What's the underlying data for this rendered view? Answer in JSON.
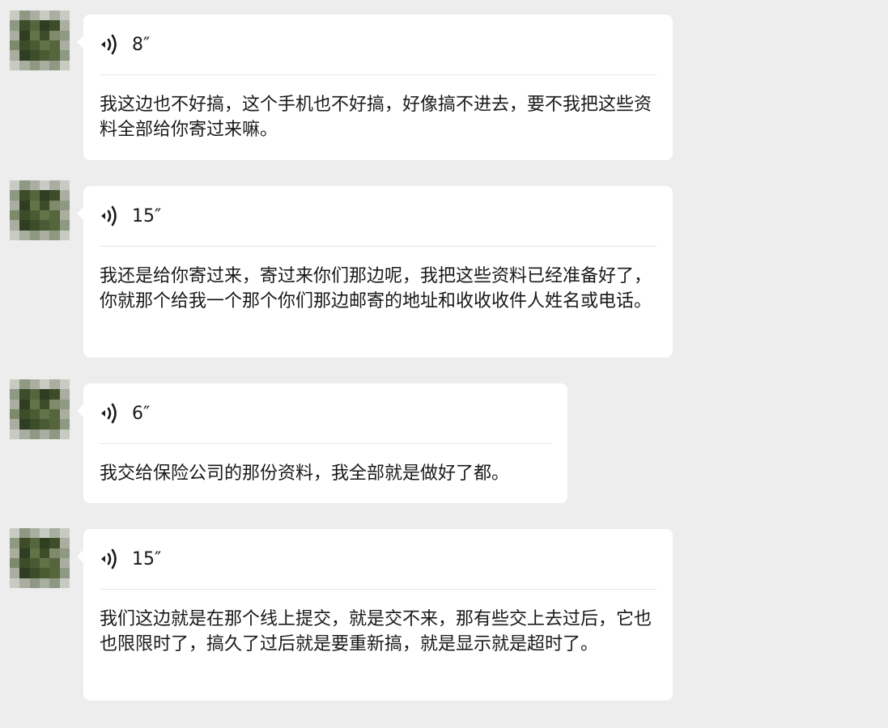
{
  "colors": {
    "background": "#ededed",
    "bubble": "#ffffff",
    "text": "#191919",
    "divider": "#e6e6e6"
  },
  "messages": [
    {
      "sender": "contact",
      "avatar": "blurred-contact-avatar",
      "icon": "voice-icon",
      "duration": "8″",
      "transcript": "我这边也不好搞，这个手机也不好搞，好像搞不进去，要不我把这些资料全部给你寄过来嘛。"
    },
    {
      "sender": "contact",
      "avatar": "blurred-contact-avatar",
      "icon": "voice-icon",
      "duration": "15″",
      "transcript": "我还是给你寄过来，寄过来你们那边呢，我把这些资料已经准备好了，你就那个给我一个那个你们那边邮寄的地址和收收收件人姓名或电话。"
    },
    {
      "sender": "contact",
      "avatar": "blurred-contact-avatar",
      "icon": "voice-icon",
      "duration": "6″",
      "transcript": "我交给保险公司的那份资料，我全部就是做好了都。"
    },
    {
      "sender": "contact",
      "avatar": "blurred-contact-avatar",
      "icon": "voice-icon",
      "duration": "15″",
      "transcript": "我们这边就是在那个线上提交，就是交不来，那有些交上去过后，它也也限限时了，搞久了过后就是要重新搞，就是显示就是超时了。"
    }
  ]
}
